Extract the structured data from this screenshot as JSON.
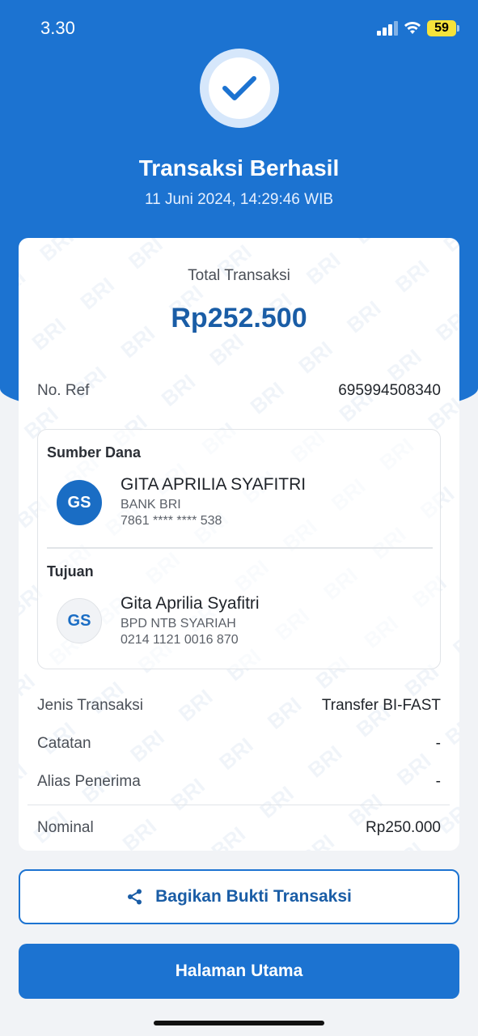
{
  "status_bar": {
    "time": "3.30",
    "battery": "59"
  },
  "header": {
    "title": "Transaksi Berhasil",
    "datetime": "11 Juni 2024, 14:29:46 WIB"
  },
  "receipt": {
    "total_label": "Total Transaksi",
    "total_amount": "Rp252.500",
    "ref_label": "No. Ref",
    "ref_value": "695994508340",
    "source": {
      "section_title": "Sumber Dana",
      "initials": "GS",
      "name": "GITA APRILIA SYAFITRI",
      "bank": "BANK BRI",
      "account": "7861 **** **** 538"
    },
    "destination": {
      "section_title": "Tujuan",
      "initials": "GS",
      "name": "Gita Aprilia Syafitri",
      "bank": "BPD NTB SYARIAH",
      "account": "0214 1121 0016 870"
    },
    "details": [
      {
        "label": "Jenis Transaksi",
        "value": "Transfer BI-FAST"
      },
      {
        "label": "Catatan",
        "value": "-"
      },
      {
        "label": "Alias Penerima",
        "value": "-"
      },
      {
        "label": "Nominal",
        "value": "Rp250.000"
      }
    ],
    "watermark": "BRI"
  },
  "actions": {
    "share_label": "Bagikan Bukti Transaksi",
    "home_label": "Halaman Utama"
  },
  "colors": {
    "primary": "#1c73d1",
    "amount": "#1a5da6"
  }
}
